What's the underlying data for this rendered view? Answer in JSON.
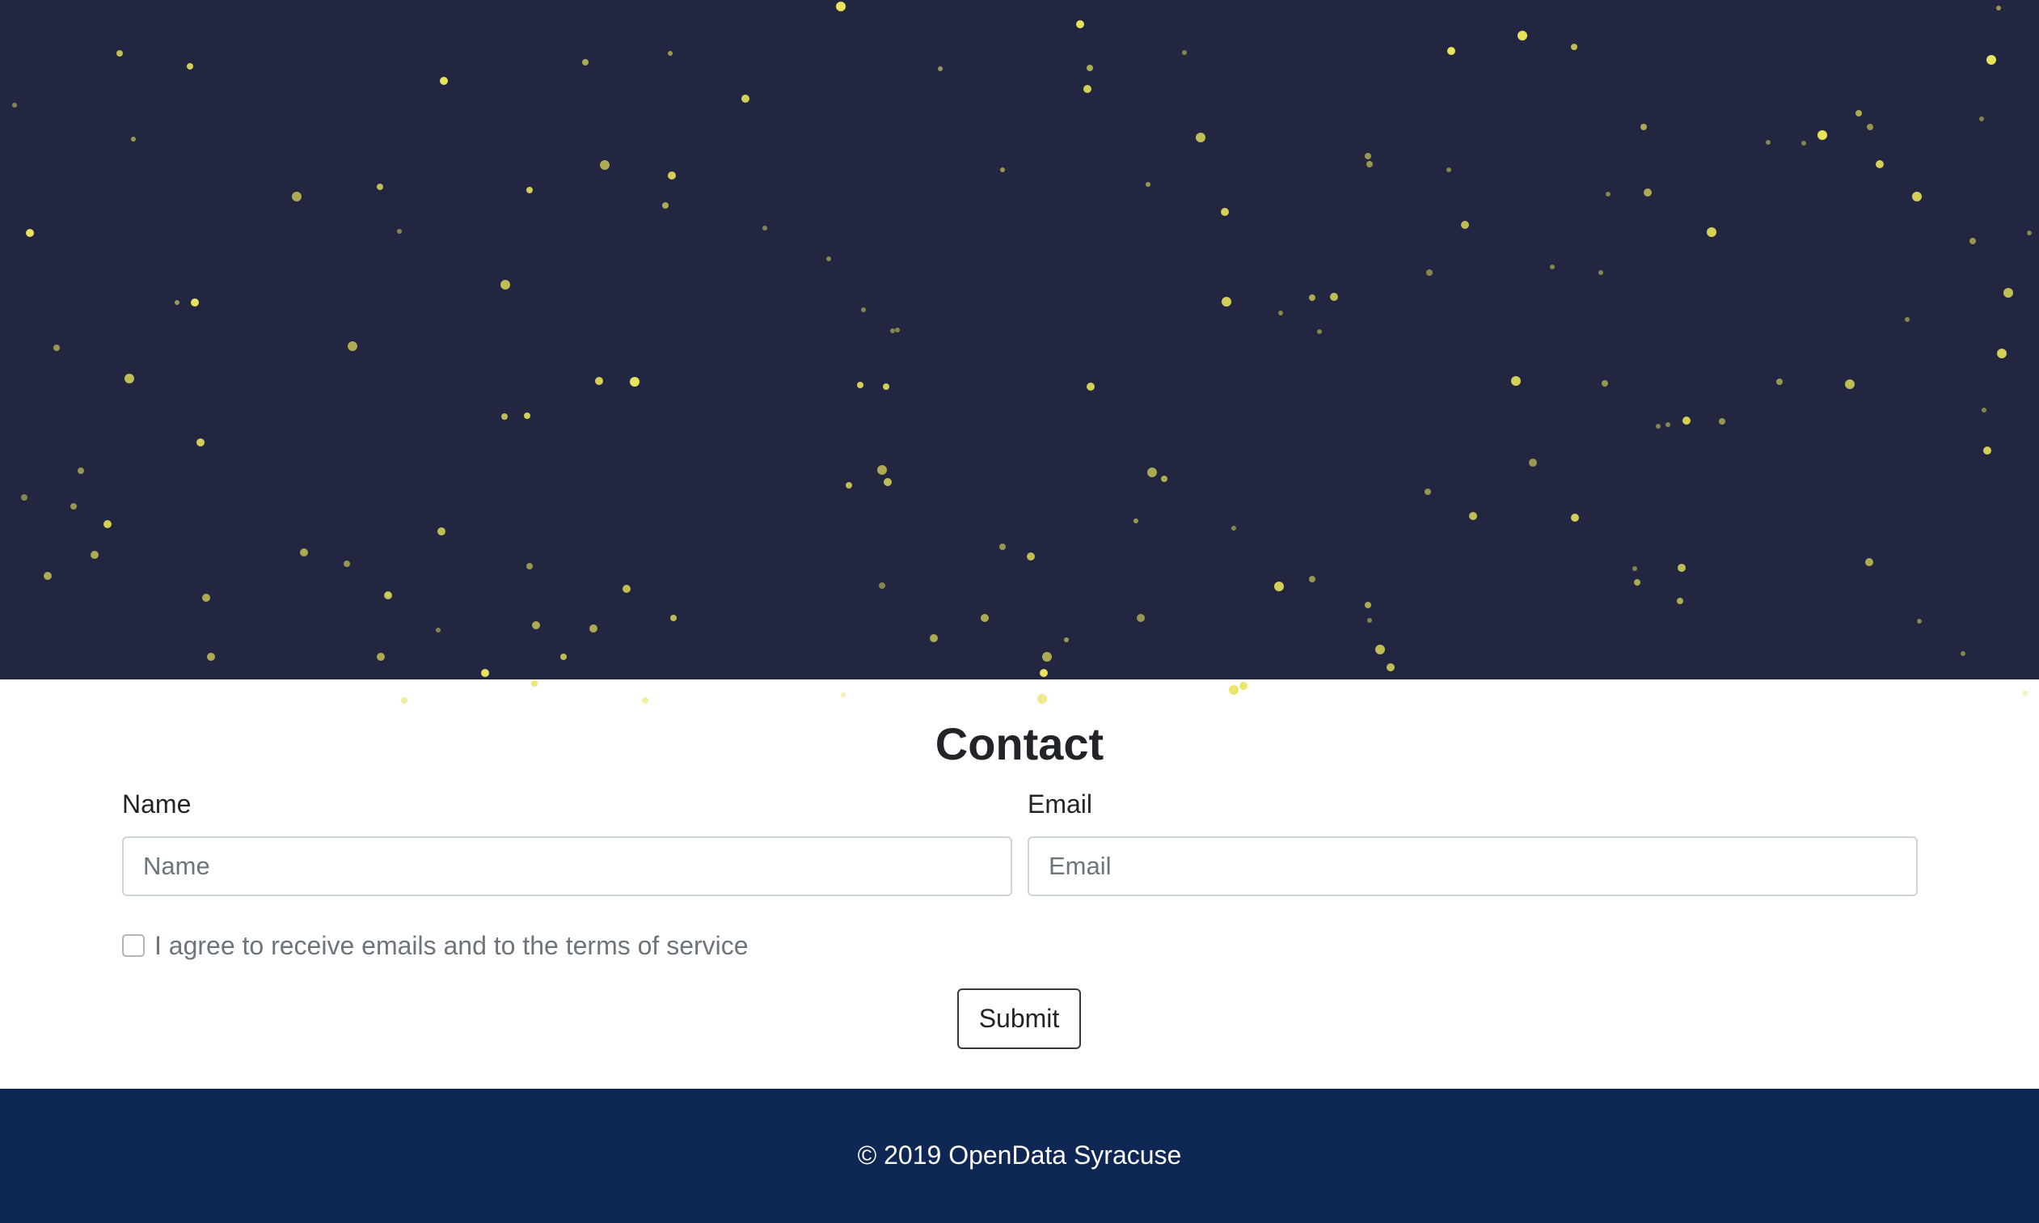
{
  "hero": {
    "background": "#222641",
    "star_color": "#e8e35a"
  },
  "contact": {
    "title": "Contact",
    "name_label": "Name",
    "name_placeholder": "Name",
    "email_label": "Email",
    "email_placeholder": "Email",
    "agree_label": "I agree to receive emails and to the terms of service",
    "agree_checked": false,
    "submit_label": "Submit"
  },
  "footer": {
    "text": "© 2019 OpenData Syracuse",
    "background": "#0e2754"
  }
}
